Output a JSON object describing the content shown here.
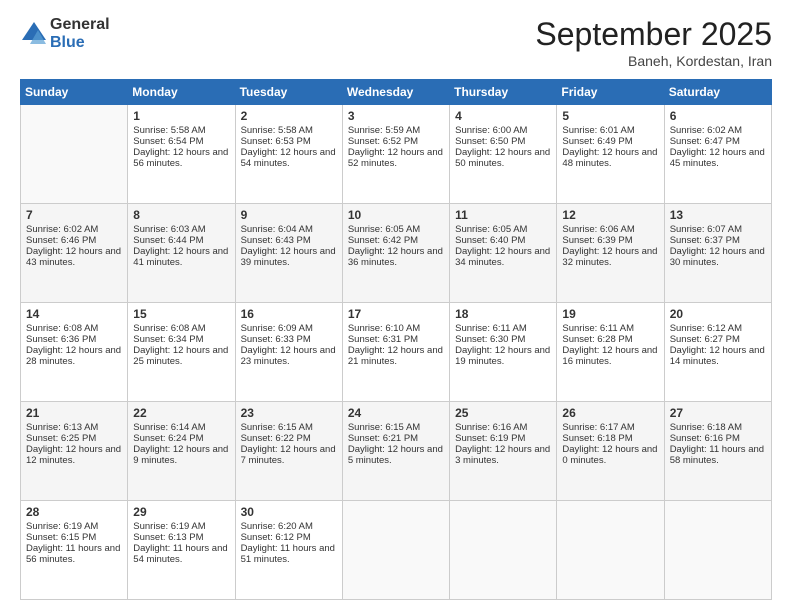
{
  "logo": {
    "general": "General",
    "blue": "Blue"
  },
  "header": {
    "month": "September 2025",
    "location": "Baneh, Kordestan, Iran"
  },
  "weekdays": [
    "Sunday",
    "Monday",
    "Tuesday",
    "Wednesday",
    "Thursday",
    "Friday",
    "Saturday"
  ],
  "weeks": [
    [
      {
        "day": "",
        "sunrise": "",
        "sunset": "",
        "daylight": ""
      },
      {
        "day": "1",
        "sunrise": "Sunrise: 5:58 AM",
        "sunset": "Sunset: 6:54 PM",
        "daylight": "Daylight: 12 hours and 56 minutes."
      },
      {
        "day": "2",
        "sunrise": "Sunrise: 5:58 AM",
        "sunset": "Sunset: 6:53 PM",
        "daylight": "Daylight: 12 hours and 54 minutes."
      },
      {
        "day": "3",
        "sunrise": "Sunrise: 5:59 AM",
        "sunset": "Sunset: 6:52 PM",
        "daylight": "Daylight: 12 hours and 52 minutes."
      },
      {
        "day": "4",
        "sunrise": "Sunrise: 6:00 AM",
        "sunset": "Sunset: 6:50 PM",
        "daylight": "Daylight: 12 hours and 50 minutes."
      },
      {
        "day": "5",
        "sunrise": "Sunrise: 6:01 AM",
        "sunset": "Sunset: 6:49 PM",
        "daylight": "Daylight: 12 hours and 48 minutes."
      },
      {
        "day": "6",
        "sunrise": "Sunrise: 6:02 AM",
        "sunset": "Sunset: 6:47 PM",
        "daylight": "Daylight: 12 hours and 45 minutes."
      }
    ],
    [
      {
        "day": "7",
        "sunrise": "Sunrise: 6:02 AM",
        "sunset": "Sunset: 6:46 PM",
        "daylight": "Daylight: 12 hours and 43 minutes."
      },
      {
        "day": "8",
        "sunrise": "Sunrise: 6:03 AM",
        "sunset": "Sunset: 6:44 PM",
        "daylight": "Daylight: 12 hours and 41 minutes."
      },
      {
        "day": "9",
        "sunrise": "Sunrise: 6:04 AM",
        "sunset": "Sunset: 6:43 PM",
        "daylight": "Daylight: 12 hours and 39 minutes."
      },
      {
        "day": "10",
        "sunrise": "Sunrise: 6:05 AM",
        "sunset": "Sunset: 6:42 PM",
        "daylight": "Daylight: 12 hours and 36 minutes."
      },
      {
        "day": "11",
        "sunrise": "Sunrise: 6:05 AM",
        "sunset": "Sunset: 6:40 PM",
        "daylight": "Daylight: 12 hours and 34 minutes."
      },
      {
        "day": "12",
        "sunrise": "Sunrise: 6:06 AM",
        "sunset": "Sunset: 6:39 PM",
        "daylight": "Daylight: 12 hours and 32 minutes."
      },
      {
        "day": "13",
        "sunrise": "Sunrise: 6:07 AM",
        "sunset": "Sunset: 6:37 PM",
        "daylight": "Daylight: 12 hours and 30 minutes."
      }
    ],
    [
      {
        "day": "14",
        "sunrise": "Sunrise: 6:08 AM",
        "sunset": "Sunset: 6:36 PM",
        "daylight": "Daylight: 12 hours and 28 minutes."
      },
      {
        "day": "15",
        "sunrise": "Sunrise: 6:08 AM",
        "sunset": "Sunset: 6:34 PM",
        "daylight": "Daylight: 12 hours and 25 minutes."
      },
      {
        "day": "16",
        "sunrise": "Sunrise: 6:09 AM",
        "sunset": "Sunset: 6:33 PM",
        "daylight": "Daylight: 12 hours and 23 minutes."
      },
      {
        "day": "17",
        "sunrise": "Sunrise: 6:10 AM",
        "sunset": "Sunset: 6:31 PM",
        "daylight": "Daylight: 12 hours and 21 minutes."
      },
      {
        "day": "18",
        "sunrise": "Sunrise: 6:11 AM",
        "sunset": "Sunset: 6:30 PM",
        "daylight": "Daylight: 12 hours and 19 minutes."
      },
      {
        "day": "19",
        "sunrise": "Sunrise: 6:11 AM",
        "sunset": "Sunset: 6:28 PM",
        "daylight": "Daylight: 12 hours and 16 minutes."
      },
      {
        "day": "20",
        "sunrise": "Sunrise: 6:12 AM",
        "sunset": "Sunset: 6:27 PM",
        "daylight": "Daylight: 12 hours and 14 minutes."
      }
    ],
    [
      {
        "day": "21",
        "sunrise": "Sunrise: 6:13 AM",
        "sunset": "Sunset: 6:25 PM",
        "daylight": "Daylight: 12 hours and 12 minutes."
      },
      {
        "day": "22",
        "sunrise": "Sunrise: 6:14 AM",
        "sunset": "Sunset: 6:24 PM",
        "daylight": "Daylight: 12 hours and 9 minutes."
      },
      {
        "day": "23",
        "sunrise": "Sunrise: 6:15 AM",
        "sunset": "Sunset: 6:22 PM",
        "daylight": "Daylight: 12 hours and 7 minutes."
      },
      {
        "day": "24",
        "sunrise": "Sunrise: 6:15 AM",
        "sunset": "Sunset: 6:21 PM",
        "daylight": "Daylight: 12 hours and 5 minutes."
      },
      {
        "day": "25",
        "sunrise": "Sunrise: 6:16 AM",
        "sunset": "Sunset: 6:19 PM",
        "daylight": "Daylight: 12 hours and 3 minutes."
      },
      {
        "day": "26",
        "sunrise": "Sunrise: 6:17 AM",
        "sunset": "Sunset: 6:18 PM",
        "daylight": "Daylight: 12 hours and 0 minutes."
      },
      {
        "day": "27",
        "sunrise": "Sunrise: 6:18 AM",
        "sunset": "Sunset: 6:16 PM",
        "daylight": "Daylight: 11 hours and 58 minutes."
      }
    ],
    [
      {
        "day": "28",
        "sunrise": "Sunrise: 6:19 AM",
        "sunset": "Sunset: 6:15 PM",
        "daylight": "Daylight: 11 hours and 56 minutes."
      },
      {
        "day": "29",
        "sunrise": "Sunrise: 6:19 AM",
        "sunset": "Sunset: 6:13 PM",
        "daylight": "Daylight: 11 hours and 54 minutes."
      },
      {
        "day": "30",
        "sunrise": "Sunrise: 6:20 AM",
        "sunset": "Sunset: 6:12 PM",
        "daylight": "Daylight: 11 hours and 51 minutes."
      },
      {
        "day": "",
        "sunrise": "",
        "sunset": "",
        "daylight": ""
      },
      {
        "day": "",
        "sunrise": "",
        "sunset": "",
        "daylight": ""
      },
      {
        "day": "",
        "sunrise": "",
        "sunset": "",
        "daylight": ""
      },
      {
        "day": "",
        "sunrise": "",
        "sunset": "",
        "daylight": ""
      }
    ]
  ]
}
